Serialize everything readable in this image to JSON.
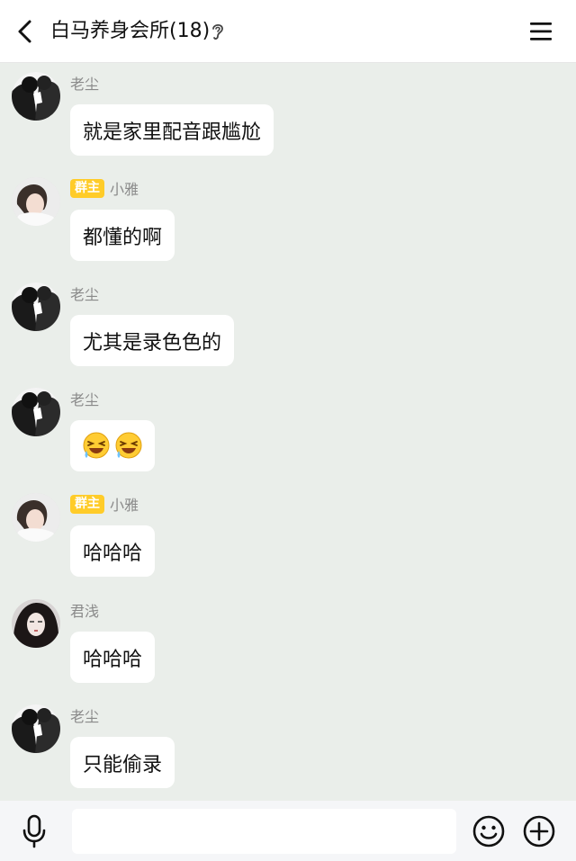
{
  "header": {
    "title": "白马养身会所(18)",
    "back_icon": "chevron-left-icon",
    "ear_icon": "ear-icon",
    "menu_icon": "hamburger-menu-icon"
  },
  "messages": [
    {
      "sender": "老尘",
      "badge": "",
      "text": "就是家里配音跟尴尬",
      "avatar": "avatar-laochen"
    },
    {
      "sender": "小雅",
      "badge": "群主",
      "text": "都懂的啊",
      "avatar": "avatar-xiaoya"
    },
    {
      "sender": "老尘",
      "badge": "",
      "text": "尤其是录色色的",
      "avatar": "avatar-laochen"
    },
    {
      "sender": "老尘",
      "badge": "",
      "text": "",
      "emoji": [
        "laugh-cry-emoji-icon",
        "laugh-cry-emoji-icon"
      ],
      "avatar": "avatar-laochen"
    },
    {
      "sender": "小雅",
      "badge": "群主",
      "text": "哈哈哈",
      "avatar": "avatar-xiaoya"
    },
    {
      "sender": "君浅",
      "badge": "",
      "text": "哈哈哈",
      "avatar": "avatar-junqian"
    },
    {
      "sender": "老尘",
      "badge": "",
      "text": "只能偷录",
      "avatar": "avatar-laochen"
    }
  ],
  "input": {
    "value": "",
    "placeholder": ""
  },
  "footer": {
    "mic_icon": "microphone-icon",
    "emoji_icon": "smiley-icon",
    "plus_icon": "plus-circle-icon"
  },
  "colors": {
    "chat_background": "#eaeeea",
    "bubble": "#ffffff",
    "badge": "#ffcc29",
    "sender_name": "#8a8a8a"
  }
}
